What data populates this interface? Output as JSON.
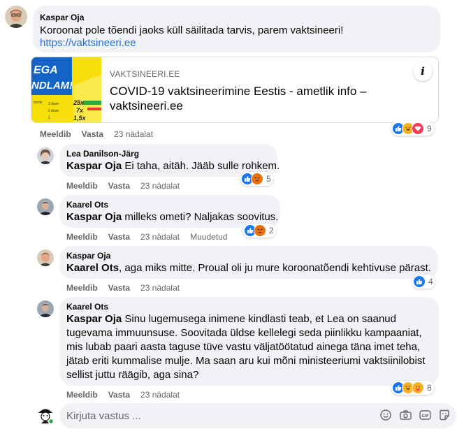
{
  "root_comment": {
    "author": "Kaspar Oja",
    "text": "Koroonat pole tõendi jaoks küll säilitada tarvis, parem vaktsineeri!",
    "link": "https://vaktsineeri.ee",
    "preview": {
      "site": "VAKTSINEERI.EE",
      "title": "COVID-19 vaktsineerimine Eestis - ametlik info – vaktsineeri.ee",
      "thumb_text_1": "EGA",
      "thumb_text_2": "NDLAM!",
      "thumb_values": [
        "25x",
        "7x",
        "1,5x"
      ],
      "thumb_row_labels": [
        "kordu",
        "3 dose",
        "2 dose",
        "1"
      ]
    },
    "like": "Meeldib",
    "reply": "Vasta",
    "time": "23 nädalat",
    "reactions": {
      "icons": [
        "like-icon",
        "haha-icon",
        "love-icon"
      ],
      "count": "9"
    }
  },
  "replies": [
    {
      "author": "Lea Danilson-Järg",
      "tag": "Kaspar Oja",
      "text": " Ei taha, aitäh. Jääb sulle rohkem.",
      "like": "Meeldib",
      "reply": "Vasta",
      "time": "23 nädalat",
      "edited": "",
      "reactions": {
        "icons": [
          "like-icon",
          "angry-icon"
        ],
        "count": "5"
      }
    },
    {
      "author": "Kaarel Ots",
      "tag": "Kaspar Oja",
      "text": " milleks ometi? Naljakas soovitus.",
      "like": "Meeldib",
      "reply": "Vasta",
      "time": "23 nädalat",
      "edited": "Muudetud",
      "reactions": {
        "icons": [
          "like-icon",
          "angry-icon"
        ],
        "count": "2"
      }
    },
    {
      "author": "Kaspar Oja",
      "tag": "Kaarel Ots",
      "text": ", aga miks mitte. Proual oli ju mure koroonatõendi kehtivuse pärast...",
      "like": "Meeldib",
      "reply": "Vasta",
      "time": "23 nädalat",
      "edited": "",
      "reactions": {
        "icons": [
          "like-icon"
        ],
        "count": "4"
      }
    },
    {
      "author": "Kaarel Ots",
      "tag": "Kaspar Oja",
      "text": " Sinu lugemusega inimene kindlasti teab, et Lea on saanud tugevama immuunsuse. Soovitada üldse kellelegi seda piinlikku kampaaniat, mis lubab paari aasta taguse tüve vastu väljatöötatud ainega täna imet teha, jätab eriti kummalise mulje. Ma saan aru kui mõni ministeeriumi vaktsiinilobist sellist juttu räägib, aga sina?",
      "like": "Meeldib",
      "reply": "Vasta",
      "time": "23 nädalat",
      "edited": "",
      "reactions": {
        "icons": [
          "like-icon",
          "haha-icon",
          "care-icon"
        ],
        "count": "8"
      }
    }
  ],
  "composer": {
    "placeholder": "Kirjuta vastus ...",
    "tools": [
      "emoji-icon",
      "camera-icon",
      "gif-icon",
      "sticker-icon"
    ]
  },
  "colors": {
    "like": "#1877f2",
    "love": "#f33e58",
    "haha": "#f7b125",
    "angry": "#e9710f",
    "link": "#216fdb",
    "muted": "#65676b",
    "bubble": "#f0f2f5"
  }
}
